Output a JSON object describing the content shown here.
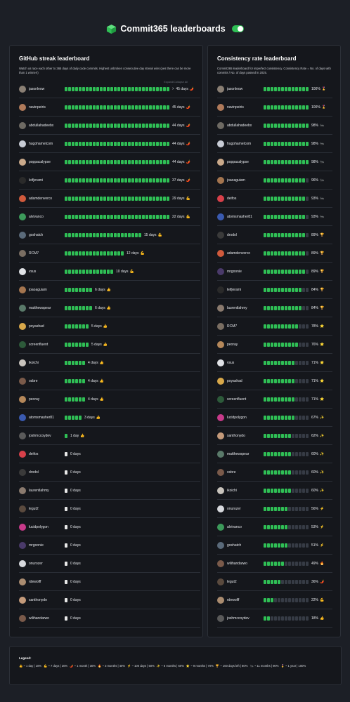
{
  "header": {
    "title": "Commit365 leaderboards"
  },
  "streak": {
    "title": "GitHub streak leaderboard",
    "description": "Watch us race each other to 365 days of daily code commits. Highest unbroken consecutive day streak wins (yes there can be more than 1 winner!)",
    "expand_label": "Expand/Collapse All",
    "rows": [
      {
        "user": "jasonleow",
        "value": "45 days",
        "emoji": "🌶️",
        "squares": 30,
        "chevron": true,
        "avatar": "#8a7f74"
      },
      {
        "user": "navinpeiris",
        "value": "45 days",
        "emoji": "🌶️",
        "squares": 30,
        "avatar": "#b07a5a"
      },
      {
        "user": "abdullahadeebx",
        "value": "44 days",
        "emoji": "🌶️",
        "squares": 30,
        "avatar": "#6e6a63"
      },
      {
        "user": "hugohamelcom",
        "value": "44 days",
        "emoji": "🌶️",
        "squares": 30,
        "avatar": "#c8ccd5"
      },
      {
        "user": "poppacalypse",
        "value": "44 days",
        "emoji": "🌶️",
        "squares": 30,
        "avatar": "#caa98a"
      },
      {
        "user": "leifjerami",
        "value": "37 days",
        "emoji": "🌶️",
        "squares": 30,
        "avatar": "#2a2a2a"
      },
      {
        "user": "adamdenverco",
        "value": "29 days",
        "emoji": "💪",
        "squares": 30,
        "avatar": "#d05a3c"
      },
      {
        "user": "alvivanco",
        "value": "22 days",
        "emoji": "💪",
        "squares": 30,
        "avatar": "#3c9a5a"
      },
      {
        "user": "goshatch",
        "value": "15 days",
        "emoji": "💪",
        "squares": 22,
        "avatar": "#5a6a7a"
      },
      {
        "user": "RCM7",
        "value": "12 days",
        "emoji": "💪",
        "squares": 17,
        "avatar": "#7a6e62"
      },
      {
        "user": "vsus",
        "value": "10 days",
        "emoji": "💪",
        "squares": 14,
        "avatar": "#e0e2e6"
      },
      {
        "user": "joaoaguiam",
        "value": "6 days",
        "emoji": "👍",
        "squares": 8,
        "avatar": "#a4754f"
      },
      {
        "user": "matthewspear",
        "value": "6 days",
        "emoji": "👍",
        "squares": 8,
        "avatar": "#5a7a6a"
      },
      {
        "user": "poyashad",
        "value": "5 days",
        "emoji": "👍",
        "squares": 7,
        "avatar": "#d8a84a"
      },
      {
        "user": "screenfluent",
        "value": "5 days",
        "emoji": "👍",
        "squares": 7,
        "avatar": "#2d5a3a"
      },
      {
        "user": "ikoichi",
        "value": "4 days",
        "emoji": "👍",
        "squares": 6,
        "avatar": "#c9c4bd"
      },
      {
        "user": "osbre",
        "value": "4 days",
        "emoji": "👍",
        "squares": 6,
        "avatar": "#7a5a4a"
      },
      {
        "user": "peoray",
        "value": "4 days",
        "emoji": "👍",
        "squares": 6,
        "avatar": "#b5885a"
      },
      {
        "user": "atomsmasher81",
        "value": "3 days",
        "emoji": "👍",
        "squares": 5,
        "avatar": "#3a5ab0"
      },
      {
        "user": "joshmccoydev",
        "value": "1 day",
        "emoji": "👍",
        "squares": 1,
        "avatar": "#5a5a5a"
      },
      {
        "user": "deifos",
        "value": "0 days",
        "emoji": "",
        "squares": 0,
        "avatar": "#d8404a"
      },
      {
        "user": "drodol",
        "value": "0 days",
        "emoji": "",
        "squares": 0,
        "avatar": "#3a3a3a"
      },
      {
        "user": "laurentlahmy",
        "value": "0 days",
        "emoji": "",
        "squares": 0,
        "avatar": "#8a7a6e"
      },
      {
        "user": "legut2",
        "value": "0 days",
        "emoji": "",
        "squares": 0,
        "avatar": "#5a4a3e"
      },
      {
        "user": "lucidpolygon",
        "value": "0 days",
        "emoji": "",
        "squares": 0,
        "avatar": "#c83a8a"
      },
      {
        "user": "mrgoonie",
        "value": "0 days",
        "emoji": "",
        "squares": 0,
        "avatar": "#4a3a6a"
      },
      {
        "user": "onurozer",
        "value": "0 days",
        "emoji": "",
        "squares": 0,
        "avatar": "#d7d9dd"
      },
      {
        "user": "rdewolff",
        "value": "0 days",
        "emoji": "",
        "squares": 0,
        "avatar": "#aa8c70"
      },
      {
        "user": "santhonydo",
        "value": "0 days",
        "emoji": "",
        "squares": 0,
        "avatar": "#c49a7a"
      },
      {
        "user": "wilihandarwo",
        "value": "0 days",
        "emoji": "",
        "squares": 0,
        "avatar": "#7a5a4a"
      }
    ]
  },
  "consistency": {
    "title": "Consistency rate leaderboard",
    "description": "Commit365 leaderboard for imperfect consistency. Consistency Rate = No. of days with commits / No. of days passed in 2025.",
    "rows": [
      {
        "user": "jasonleow",
        "value": "100%",
        "emoji": "🎖️",
        "rate": 100,
        "avatar": "#8a7f74"
      },
      {
        "user": "navinpeiris",
        "value": "100%",
        "emoji": "🎖️",
        "rate": 100,
        "avatar": "#b07a5a"
      },
      {
        "user": "abdullahadeebx",
        "value": "98%",
        "emoji": "🐜",
        "rate": 98,
        "avatar": "#6e6a63"
      },
      {
        "user": "hugohamelcom",
        "value": "98%",
        "emoji": "🐜",
        "rate": 98,
        "avatar": "#c8ccd5"
      },
      {
        "user": "poppacalypse",
        "value": "98%",
        "emoji": "🐜",
        "rate": 98,
        "avatar": "#caa98a"
      },
      {
        "user": "joaoaguiam",
        "value": "96%",
        "emoji": "🐜",
        "rate": 96,
        "avatar": "#a4754f"
      },
      {
        "user": "deifos",
        "value": "93%",
        "emoji": "🐜",
        "rate": 93,
        "avatar": "#d8404a"
      },
      {
        "user": "atomsmasher81",
        "value": "93%",
        "emoji": "🐜",
        "rate": 93,
        "avatar": "#3a5ab0"
      },
      {
        "user": "drodol",
        "value": "89%",
        "emoji": "🏆",
        "rate": 89,
        "avatar": "#3a3a3a"
      },
      {
        "user": "adamdenverco",
        "value": "89%",
        "emoji": "🏆",
        "rate": 89,
        "avatar": "#d05a3c"
      },
      {
        "user": "mrgoonie",
        "value": "89%",
        "emoji": "🏆",
        "rate": 89,
        "avatar": "#4a3a6a"
      },
      {
        "user": "leifjerami",
        "value": "84%",
        "emoji": "🏆",
        "rate": 84,
        "avatar": "#2a2a2a"
      },
      {
        "user": "laurentlahmy",
        "value": "84%",
        "emoji": "🏆",
        "rate": 84,
        "avatar": "#8a7a6e"
      },
      {
        "user": "RCM7",
        "value": "78%",
        "emoji": "⭐",
        "rate": 78,
        "avatar": "#7a6e62"
      },
      {
        "user": "peoray",
        "value": "76%",
        "emoji": "⭐",
        "rate": 76,
        "avatar": "#b5885a"
      },
      {
        "user": "vsus",
        "value": "71%",
        "emoji": "⭐",
        "rate": 71,
        "avatar": "#e0e2e6"
      },
      {
        "user": "poyashad",
        "value": "71%",
        "emoji": "⭐",
        "rate": 71,
        "avatar": "#d8a84a"
      },
      {
        "user": "screenfluent",
        "value": "71%",
        "emoji": "⭐",
        "rate": 71,
        "avatar": "#2d5a3a"
      },
      {
        "user": "lucidpolygon",
        "value": "67%",
        "emoji": "✨",
        "rate": 67,
        "avatar": "#c83a8a"
      },
      {
        "user": "santhonydo",
        "value": "62%",
        "emoji": "✨",
        "rate": 62,
        "avatar": "#c49a7a"
      },
      {
        "user": "matthewspear",
        "value": "60%",
        "emoji": "✨",
        "rate": 60,
        "avatar": "#5a7a6a"
      },
      {
        "user": "osbre",
        "value": "60%",
        "emoji": "✨",
        "rate": 60,
        "avatar": "#7a5a4a"
      },
      {
        "user": "ikoichi",
        "value": "60%",
        "emoji": "✨",
        "rate": 60,
        "avatar": "#c9c4bd"
      },
      {
        "user": "onurozer",
        "value": "56%",
        "emoji": "⚡",
        "rate": 56,
        "avatar": "#d7d9dd"
      },
      {
        "user": "alvivanco",
        "value": "53%",
        "emoji": "⚡",
        "rate": 53,
        "avatar": "#3c9a5a"
      },
      {
        "user": "goshatch",
        "value": "51%",
        "emoji": "⚡",
        "rate": 51,
        "avatar": "#5a6a7a"
      },
      {
        "user": "wilihandarwo",
        "value": "49%",
        "emoji": "🔥",
        "rate": 49,
        "avatar": "#7a5a4a"
      },
      {
        "user": "legut2",
        "value": "36%",
        "emoji": "🌶️",
        "rate": 36,
        "avatar": "#5a4a3e"
      },
      {
        "user": "rdewolff",
        "value": "22%",
        "emoji": "💪",
        "rate": 22,
        "avatar": "#aa8c70"
      },
      {
        "user": "joshmccoydev",
        "value": "18%",
        "emoji": "👍",
        "rate": 18,
        "avatar": "#5a5a5a"
      }
    ]
  },
  "legend": {
    "title": "Legend:",
    "items": [
      "👍 ~ 1 day | 10%",
      "💪 ~ 7 days | 20%",
      "🌶️ ~ 1 month | 30%",
      "🔥 ~ 3 months | 40%",
      "⚡ ~ 100 days | 50%",
      "✨ ~ 6 months | 60%",
      "⭐ ~ 9 months | 70%",
      "🏆 ~ 100 days left | 80%",
      "🐜 ~ 11 months | 90%",
      "🎖️ ~ 1 year | 100%"
    ]
  },
  "colors": {
    "background": "#1c1f26",
    "card": "#15171c",
    "accent_green": "#2fbf55",
    "empty_square": "#363b45"
  }
}
